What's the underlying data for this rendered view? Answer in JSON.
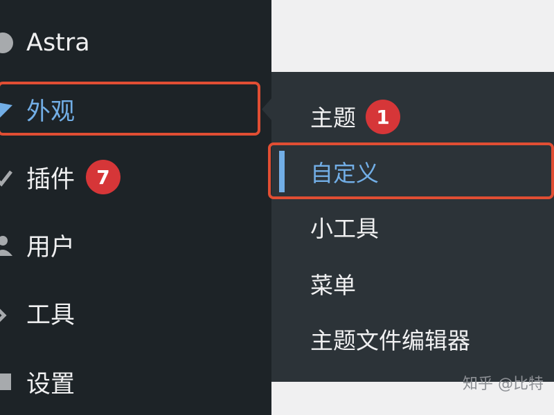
{
  "sidebar": {
    "items": [
      {
        "label": "Astra",
        "icon": "astra-icon"
      },
      {
        "label": "外观",
        "icon": "appearance-brush-icon"
      },
      {
        "label": "插件",
        "icon": "plugins-icon",
        "badge": "7"
      },
      {
        "label": "用户",
        "icon": "users-icon"
      },
      {
        "label": "工具",
        "icon": "tools-icon"
      },
      {
        "label": "设置",
        "icon": "settings-icon"
      }
    ]
  },
  "flyout": {
    "items": [
      {
        "label": "主题",
        "badge": "1"
      },
      {
        "label": "自定义",
        "current": true
      },
      {
        "label": "小工具"
      },
      {
        "label": "菜单"
      },
      {
        "label": "主题文件编辑器"
      }
    ]
  },
  "watermark": "知乎 @比特",
  "colors": {
    "sidebar_bg": "#1d2327",
    "flyout_bg": "#2c3338",
    "accent": "#72aee6",
    "badge": "#d63638",
    "highlight": "#e14e33"
  }
}
